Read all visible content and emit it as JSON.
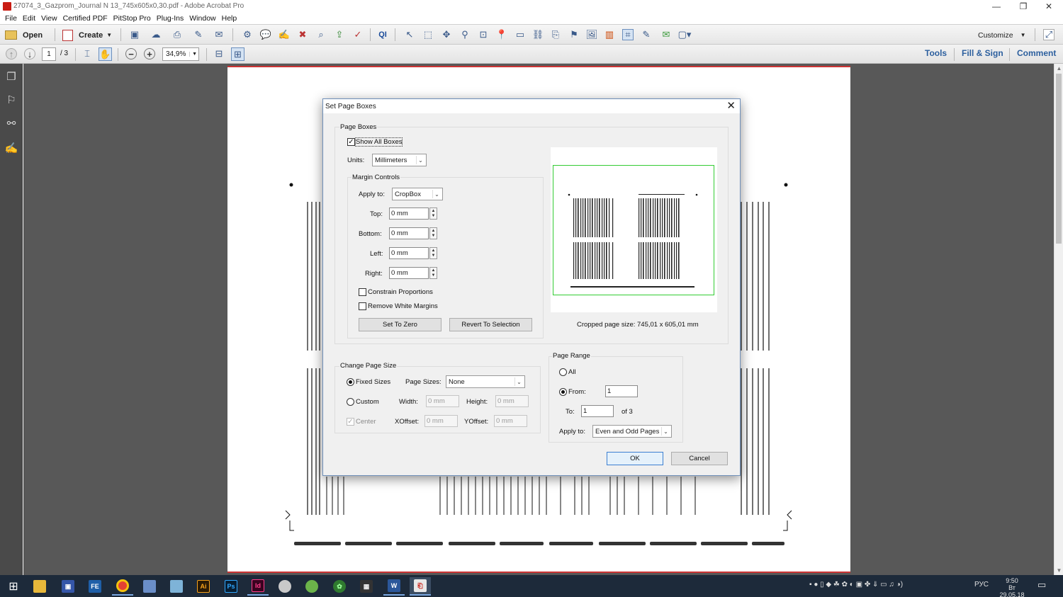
{
  "window": {
    "title": "27074_3_Gazprom_Journal N 13_745x605x0,30.pdf - Adobe Acrobat Pro",
    "controls": [
      "—",
      "❐",
      "✕"
    ]
  },
  "menubar": [
    "File",
    "Edit",
    "View",
    "Certified PDF",
    "PitStop Pro",
    "Plug-Ins",
    "Window",
    "Help"
  ],
  "toolbar": {
    "open_label": "Open",
    "create_label": "Create",
    "customize_label": "Customize"
  },
  "nav": {
    "page_current": "1",
    "page_total": "/ 3",
    "zoom": "34,9%"
  },
  "panels": {
    "tools": "Tools",
    "fill_sign": "Fill & Sign",
    "comment": "Comment"
  },
  "dialog": {
    "title": "Set Page Boxes",
    "page_boxes_group": "Page Boxes",
    "show_all_boxes": "Show All Boxes",
    "units_label": "Units:",
    "units_value": "Millimeters",
    "margin_controls_group": "Margin Controls",
    "apply_to_label": "Apply to:",
    "apply_to_value": "CropBox",
    "top_label": "Top:",
    "top_value": "0 mm",
    "bottom_label": "Bottom:",
    "bottom_value": "0 mm",
    "left_label": "Left:",
    "left_value": "0 mm",
    "right_label": "Right:",
    "right_value": "0 mm",
    "constrain_label": "Constrain Proportions",
    "remove_white_label": "Remove White Margins",
    "set_to_zero": "Set To Zero",
    "revert_to_selection": "Revert To Selection",
    "cropped_size": "Cropped page size: 745,01 x 605,01 mm",
    "change_page_size_group": "Change Page Size",
    "fixed_sizes_label": "Fixed Sizes",
    "page_sizes_label": "Page Sizes:",
    "page_sizes_value": "None",
    "custom_label": "Custom",
    "width_label": "Width:",
    "width_value": "0 mm",
    "height_label": "Height:",
    "height_value": "0 mm",
    "center_label": "Center",
    "xoffset_label": "XOffset:",
    "xoffset_value": "0 mm",
    "yoffset_label": "YOffset:",
    "yoffset_value": "0 mm",
    "page_range_group": "Page Range",
    "all_label": "All",
    "from_label": "From:",
    "from_value": "1",
    "to_label": "To:",
    "to_value": "1",
    "of_total": "of 3",
    "range_apply_label": "Apply to:",
    "range_apply_value": "Even and Odd Pages",
    "ok": "OK",
    "cancel": "Cancel"
  },
  "taskbar": {
    "lang": "РУС",
    "time": "9:50",
    "date": "Вт 29.05.18"
  }
}
